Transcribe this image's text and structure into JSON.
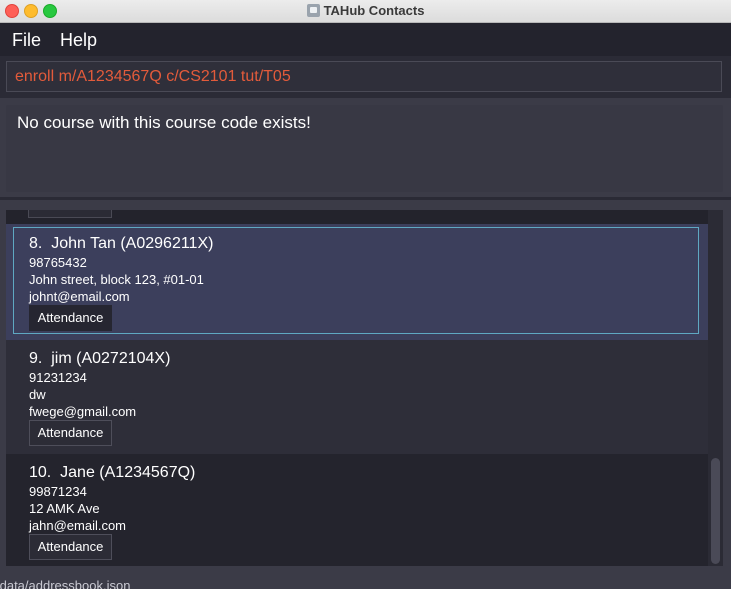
{
  "window": {
    "title": "TAHub Contacts"
  },
  "menu": {
    "file": "File",
    "help": "Help"
  },
  "command": {
    "value": "enroll m/A1234567Q c/CS2101 tut/T05"
  },
  "result": {
    "message": "No course with this course code exists!"
  },
  "persons": [
    {
      "index": "8.",
      "name": "John Tan",
      "matric": "(A0296211X)",
      "phone": "98765432",
      "address": "John street, block 123, #01-01",
      "email": "johnt@email.com",
      "button": "Attendance",
      "selected": true
    },
    {
      "index": "9.",
      "name": "jim",
      "matric": "(A0272104X)",
      "phone": "91231234",
      "address": "dw",
      "email": "fwege@gmail.com",
      "button": "Attendance",
      "selected": false
    },
    {
      "index": "10.",
      "name": "Jane",
      "matric": "(A1234567Q)",
      "phone": "99871234",
      "address": "12 AMK Ave",
      "email": "jahn@email.com",
      "button": "Attendance",
      "selected": false
    }
  ],
  "status": {
    "path": "/data/addressbook.json"
  },
  "icons": {
    "app": "contacts-app-icon",
    "close": "close-icon",
    "minimize": "minimize-icon",
    "maximize": "maximize-icon"
  },
  "colors": {
    "command_text": "#e35b3b",
    "selected_card": "#3c3f5c",
    "selection_border": "#5fa8c2"
  }
}
